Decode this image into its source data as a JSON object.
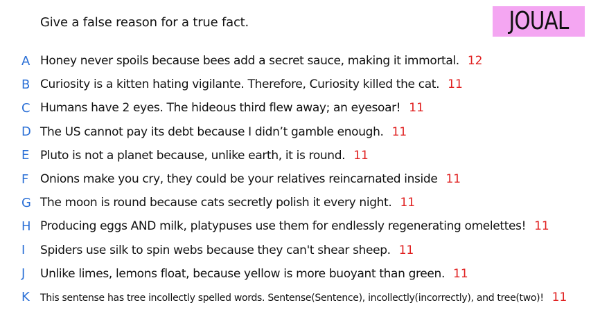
{
  "prompt": "Give a false reason for a true fact.",
  "brand": "JOUAL",
  "colors": {
    "letter": "#2a6fd6",
    "score": "#e02020",
    "brand_bg": "#f4a6f2"
  },
  "answers": [
    {
      "letter": "A",
      "text": "Honey never spoils because bees add a secret sauce, making it immortal.",
      "score": "12"
    },
    {
      "letter": "B",
      "text": "Curiosity is a kitten hating vigilante. Therefore, Curiosity killed the cat.",
      "score": "11"
    },
    {
      "letter": "C",
      "text": "Humans have 2 eyes. The hideous third flew away; an eyesoar!",
      "score": "11"
    },
    {
      "letter": "D",
      "text": "The US cannot pay its debt because I didn’t gamble enough.",
      "score": "11"
    },
    {
      "letter": "E",
      "text": "Pluto is not a planet because, unlike earth, it is round.",
      "score": "11"
    },
    {
      "letter": "F",
      "text": "Onions make you cry, they could be your relatives reincarnated inside",
      "score": "11"
    },
    {
      "letter": "G",
      "text": "The moon is round because cats secretly polish it every night.",
      "score": "11"
    },
    {
      "letter": "H",
      "text": "Producing eggs AND milk, platypuses use them for endlessly regenerating omelettes!",
      "score": "11"
    },
    {
      "letter": "I",
      "text": "Spiders use silk to spin webs because they can't shear sheep.",
      "score": "11"
    },
    {
      "letter": "J",
      "text": "Unlike limes, lemons float, because yellow is more buoyant than green.",
      "score": "11"
    },
    {
      "letter": "K",
      "text": "This sentense has tree incollectly spelled words. Sentense(Sentence), incollectly(incorrectly), and tree(two)!",
      "score": "11"
    }
  ]
}
